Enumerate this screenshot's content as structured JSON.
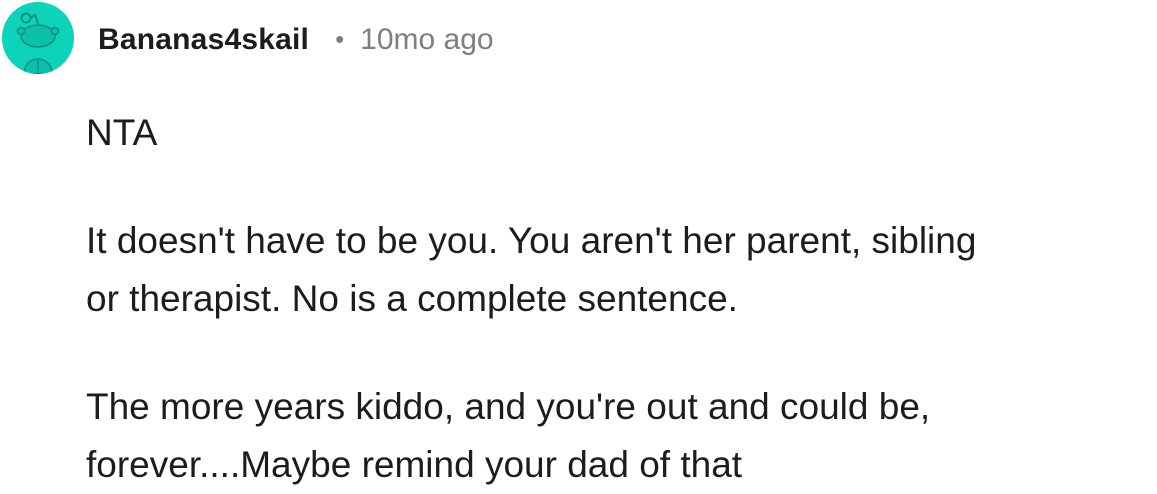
{
  "comment": {
    "avatar_icon": "reddit-snoo-avatar-icon",
    "avatar_color": "#0dd3bb",
    "username": "Bananas4skail",
    "separator": "•",
    "timestamp": "10mo ago",
    "paragraphs": [
      {
        "lines": [
          "NTA"
        ]
      },
      {
        "lines": [
          "It doesn't have to be you. You aren't her parent, sibling",
          "or therapist. No is a complete sentence."
        ]
      },
      {
        "lines": [
          "The more years kiddo, and you're out and could be,",
          "forever....Maybe remind your dad of that"
        ]
      }
    ]
  }
}
